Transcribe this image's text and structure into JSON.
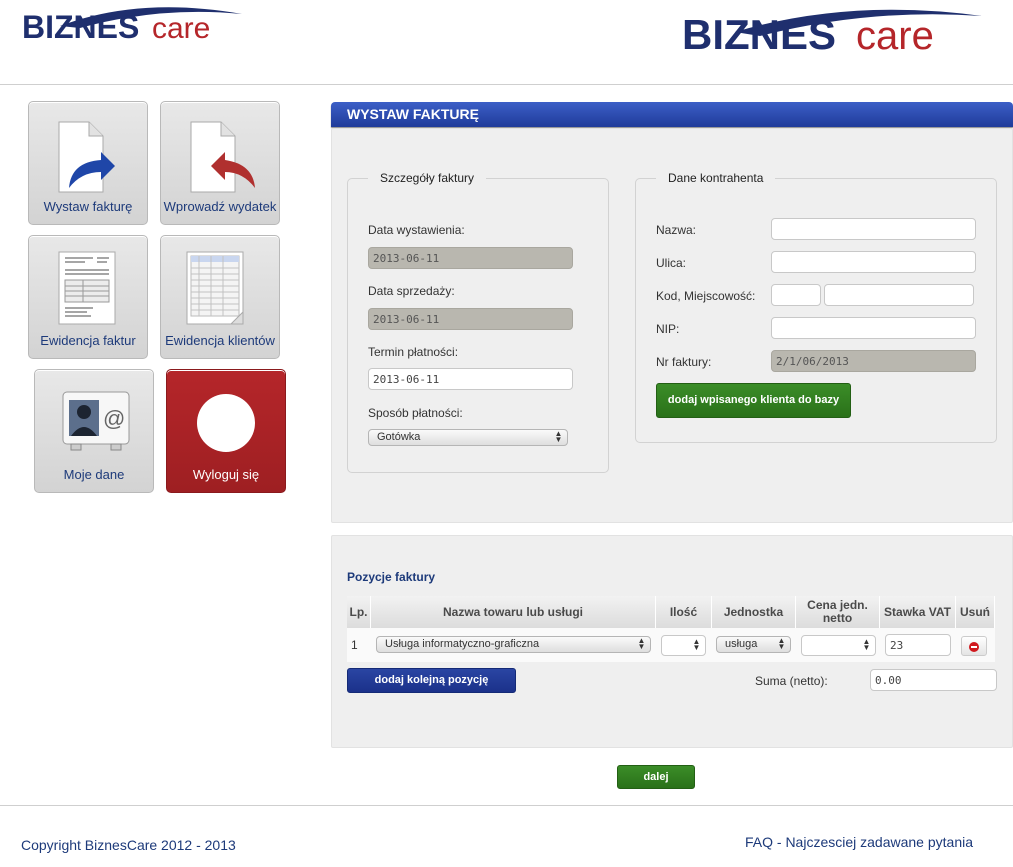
{
  "brand": {
    "logo_left": "BIZNES",
    "logo_right": "care"
  },
  "tiles": [
    {
      "label": "Wystaw fakturę",
      "icon": "issue-invoice-icon"
    },
    {
      "label": "Wprowadź wydatek",
      "icon": "enter-expense-icon"
    },
    {
      "label": "Ewidencja faktur",
      "icon": "invoice-register-icon"
    },
    {
      "label": "Ewidencja klientów",
      "icon": "client-register-icon"
    },
    {
      "label": "Moje dane",
      "icon": "contact-card-icon"
    },
    {
      "label": "Wyloguj się",
      "icon": "logout-circle-icon"
    }
  ],
  "page_title": "WYSTAW FAKTURĘ",
  "invoice_details": {
    "legend": "Szczegóły faktury",
    "issue_date_label": "Data wystawienia:",
    "issue_date": "2013-06-11",
    "sale_date_label": "Data sprzedaży:",
    "sale_date": "2013-06-11",
    "due_date_label": "Termin płatności:",
    "due_date": "2013-06-11",
    "payment_method_label": "Sposób płatności:",
    "payment_method": "Gotówka"
  },
  "contractor": {
    "legend": "Dane kontrahenta",
    "name_label": "Nazwa:",
    "name": "",
    "street_label": "Ulica:",
    "street": "",
    "postal_city_label": "Kod, Miejscowość:",
    "postal_code": "",
    "city": "",
    "nip_label": "NIP:",
    "nip": "",
    "invoice_no_label": "Nr faktury:",
    "invoice_no": "2/1/06/2013",
    "add_client_button": "dodaj wpisanego klienta do bazy"
  },
  "items": {
    "title": "Pozycje faktury",
    "headers": {
      "lp": "Lp.",
      "name": "Nazwa towaru lub usługi",
      "qty": "Ilość",
      "unit": "Jednostka",
      "price_line1": "Cena jedn.",
      "price_line2": "netto",
      "vat": "Stawka VAT",
      "remove": "Usuń"
    },
    "rows": [
      {
        "lp": "1",
        "name": "Usługa informatyczno-graficzna",
        "qty": "",
        "unit": "usługa",
        "price": "",
        "vat": "23"
      }
    ],
    "add_row_button": "dodaj kolejną pozycję",
    "sum_label": "Suma (netto):",
    "sum_value": "0.00"
  },
  "next_button": "dalej",
  "footer": {
    "copyright": "Copyright BiznesCare 2012 - 2013",
    "faq": "FAQ - Najczesciej zadawane pytania"
  },
  "colors": {
    "brand_blue": "#1d3a7a",
    "brand_red": "#b5262a",
    "green": "#2f7d20",
    "title_blue": "#2a4bb0"
  }
}
